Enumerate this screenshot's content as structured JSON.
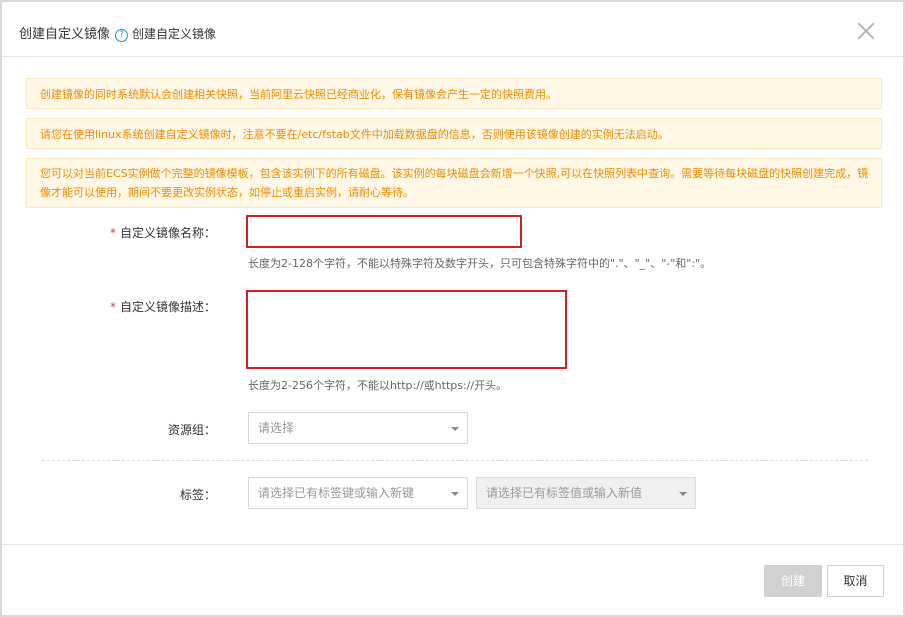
{
  "dialog": {
    "title": "创建自定义镜像",
    "help_link": "创建自定义镜像"
  },
  "notices": [
    "创建镜像的同时系统默认会创建相关快照，当前阿里云快照已经商业化，保有镜像会产生一定的快照费用。",
    "请您在使用linux系统创建自定义镜像时，注意不要在/etc/fstab文件中加载数据盘的信息，否则使用该镜像创建的实例无法启动。",
    "您可以对当前ECS实例做个完整的镜像模板，包含该实例下的所有磁盘。该实例的每块磁盘会新增一个快照,可以在快照列表中查询。需要等待每块磁盘的快照创建完成，镜像才能可以使用，期间不要更改实例状态，如停止或重启实例，请耐心等待。"
  ],
  "form": {
    "required_mark": "*",
    "name_label": "自定义镜像名称：",
    "name_value": "",
    "name_hint": "长度为2-128个字符，不能以特殊字符及数字开头，只可包含特殊字符中的\".\"、\"_\"、\"-\"和\":\"。",
    "desc_label": "自定义镜像描述：",
    "desc_value": "",
    "desc_hint": "长度为2-256个字符，不能以http://或https://开头。",
    "resource_group_label": "资源组：",
    "resource_group_placeholder": "请选择",
    "tag_label": "标签：",
    "tag_key_placeholder": "请选择已有标签键或输入新键",
    "tag_value_placeholder": "请选择已有标签值或输入新值"
  },
  "buttons": {
    "create": "创建",
    "cancel": "取消"
  },
  "colors": {
    "notice_text": "#f08a00",
    "notice_bg": "#fff8e6",
    "highlight_border": "#d61f1f",
    "help_blue": "#1a8fe3"
  }
}
